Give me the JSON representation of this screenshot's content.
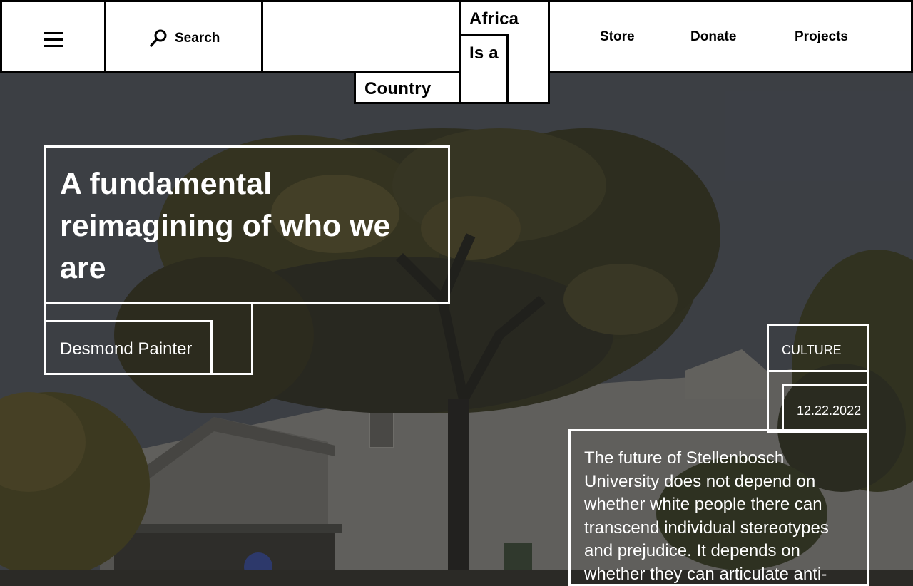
{
  "header": {
    "menu_icon": "hamburger-menu-icon",
    "search": {
      "label": "Search",
      "icon": "search-icon"
    },
    "logo": {
      "line1": "Africa",
      "line2": "Is a",
      "line3": "Country"
    },
    "nav": [
      {
        "label": "Store"
      },
      {
        "label": "Donate"
      },
      {
        "label": "Projects"
      }
    ]
  },
  "article": {
    "title": "A fundamental reimagining of who we are",
    "author": "Desmond Painter",
    "category": "CULTURE",
    "date": "12.22.2022",
    "excerpt": "The future of Stellenbosch University does not depend on whether white people there can transcend individual stereotypes and prejudice. It depends on whether they can articulate anti-"
  },
  "colors": {
    "header_background": "#ffffff",
    "border": "#000000",
    "overlay_text": "#ffffff"
  }
}
